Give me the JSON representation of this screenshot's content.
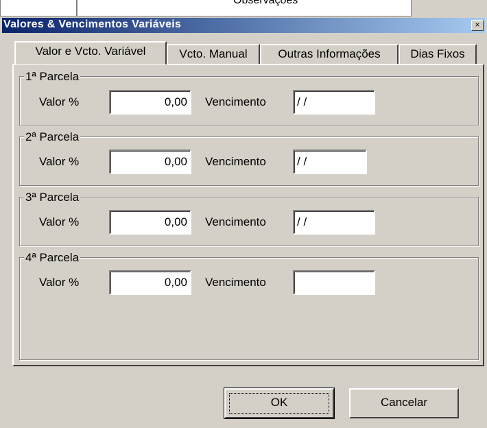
{
  "window": {
    "title": "Valores & Vencimentos Variáveis",
    "close_glyph": "×"
  },
  "background": {
    "partial_text": "Observações"
  },
  "tabs": [
    {
      "label": "Valor e Vcto. Variável",
      "active": true
    },
    {
      "label": "Vcto. Manual",
      "active": false
    },
    {
      "label": "Outras Informações",
      "active": false
    },
    {
      "label": "Dias Fixos",
      "active": false
    }
  ],
  "parcelas": [
    {
      "title": "1ª Parcela",
      "valor_label": "Valor %",
      "valor": "0,00",
      "venc_label": "Vencimento",
      "vencimento": " /  /"
    },
    {
      "title": "2ª Parcela",
      "valor_label": "Valor %",
      "valor": "0,00",
      "venc_label": "Vencimento",
      "vencimento": " /  /"
    },
    {
      "title": "3ª Parcela",
      "valor_label": "Valor %",
      "valor": "0,00",
      "venc_label": "Vencimento",
      "vencimento": " /  /"
    },
    {
      "title": "4ª Parcela",
      "valor_label": "Valor %",
      "valor": "0,00",
      "venc_label": "Vencimento",
      "vencimento": ""
    }
  ],
  "buttons": {
    "ok": "OK",
    "cancel": "Cancelar"
  }
}
